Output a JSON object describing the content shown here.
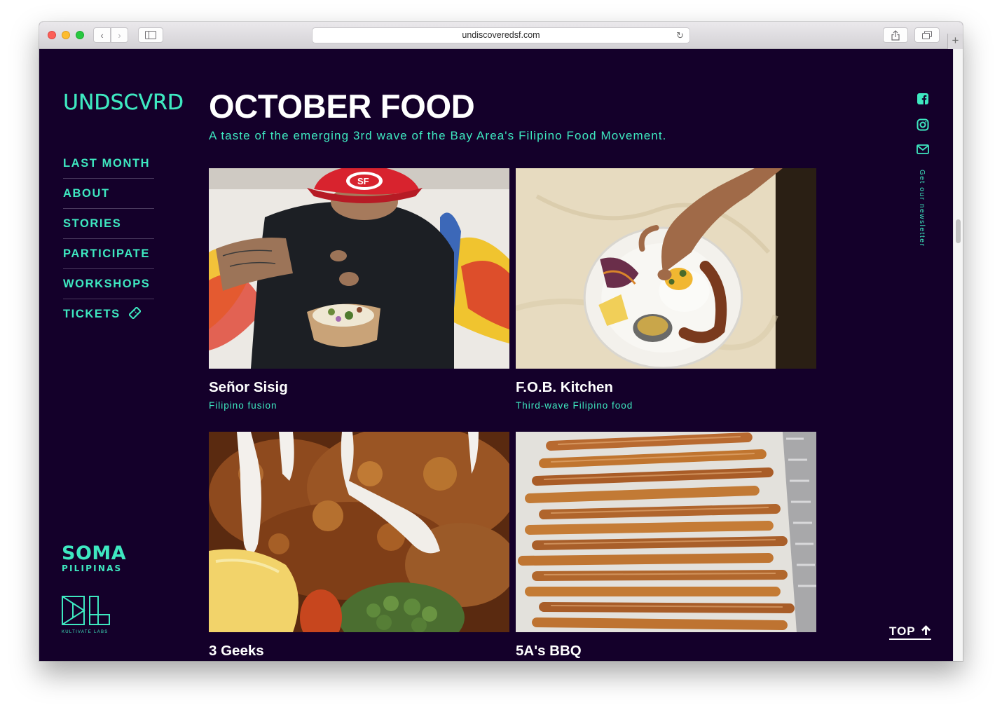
{
  "browser": {
    "url": "undiscoveredsf.com",
    "back_icon": "‹",
    "forward_icon": "›",
    "reload_icon": "↻",
    "newtab_icon": "+"
  },
  "site": {
    "logo": "UNDSCVRD",
    "nav": [
      {
        "label": "LAST MONTH"
      },
      {
        "label": "ABOUT"
      },
      {
        "label": "STORIES"
      },
      {
        "label": "PARTICIPATE"
      },
      {
        "label": "WORKSHOPS"
      },
      {
        "label": "TICKETS"
      }
    ],
    "soma": {
      "big": "SOMA",
      "small": "PILIPINAS"
    },
    "kultivate": {
      "label": "KULTIVATE LABS"
    },
    "accent": "#3ee8c0",
    "background": "#14002a"
  },
  "main": {
    "title": "OCTOBER FOOD",
    "subtitle": "A taste of the emerging 3rd wave of the Bay Area's Filipino Food Movement.",
    "cards": [
      {
        "name": "Señor Sisig",
        "desc": "Filipino fusion",
        "image": "chef sprinkling seasoning on food, 49ers cap"
      },
      {
        "name": "F.O.B. Kitchen",
        "desc": "Third-wave Filipino food",
        "image": "plated longganisa and egg"
      },
      {
        "name": "3 Geeks",
        "desc": "",
        "image": "fried chicken with sauce and lemon"
      },
      {
        "name": "5A's BBQ",
        "desc": "",
        "image": "tray of lumpia"
      }
    ]
  },
  "side": {
    "newsletter": "Get our newsletter",
    "top": "TOP"
  }
}
